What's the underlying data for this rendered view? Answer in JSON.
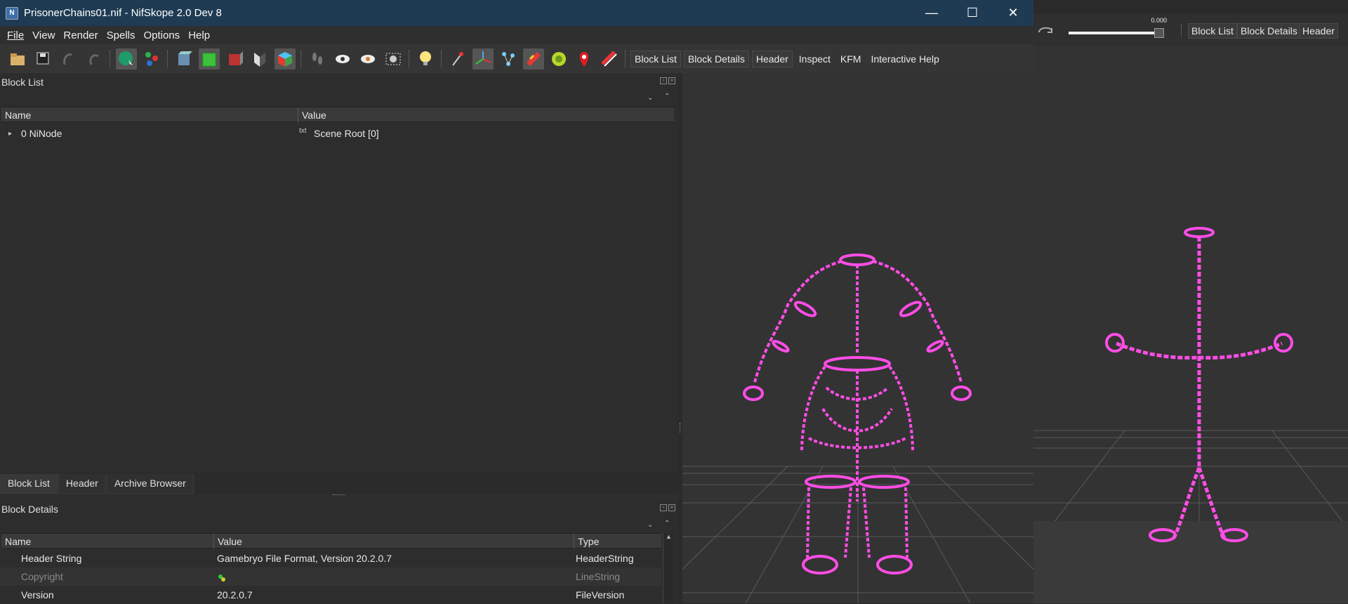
{
  "window": {
    "title": "PrisonerChains01.nif - NifSkope 2.0 Dev 8",
    "minimize_glyph": "—",
    "maximize_glyph": "☐",
    "close_glyph": "✕"
  },
  "menu": [
    "File",
    "View",
    "Render",
    "Spells",
    "Options",
    "Help"
  ],
  "toolbar": {
    "icons": [
      "load-icon",
      "save-icon",
      "undo-icon",
      "redo-icon",
      "select-mode-icon",
      "tree-mode-icon",
      "front-view-icon",
      "perspective-view-icon",
      "side-view-icon",
      "flip-view-icon",
      "user-view-icon",
      "walk-icon",
      "show-hidden-icon",
      "show-hidden-alt-icon",
      "screenshot-icon",
      "lighting-icon",
      "marker-icon",
      "axes-icon",
      "nodes-icon",
      "textures-icon",
      "frame-icon",
      "collision-icon",
      "constraint-icon"
    ],
    "dock_buttons": [
      "Block List",
      "Block Details",
      "Header",
      "Inspect",
      "KFM",
      "Interactive Help"
    ]
  },
  "block_list": {
    "title": "Block List",
    "columns": [
      "Name",
      "Value"
    ],
    "rows": [
      {
        "name": "0 NiNode",
        "value": "Scene Root [0]"
      }
    ]
  },
  "bottom_tabs": [
    "Block List",
    "Header",
    "Archive Browser"
  ],
  "block_details": {
    "title": "Block Details",
    "columns": [
      "Name",
      "Value",
      "Type"
    ],
    "rows": [
      {
        "name": "Header String",
        "value": "Gamebryo File Format, Version 20.2.0.7",
        "type": "HeaderString",
        "dim": false
      },
      {
        "name": "Copyright",
        "value": "",
        "type": "LineString",
        "dim": true
      },
      {
        "name": "Version",
        "value": "20.2.0.7",
        "type": "FileVersion",
        "dim": false
      }
    ]
  },
  "second_window": {
    "time_value": "0.000",
    "dock_buttons": [
      "Block List",
      "Block Details",
      "Header"
    ]
  },
  "colors": {
    "mesh": "#ff4de6",
    "titlebar": "#1f3b53",
    "grid": "#5a5a5a"
  }
}
